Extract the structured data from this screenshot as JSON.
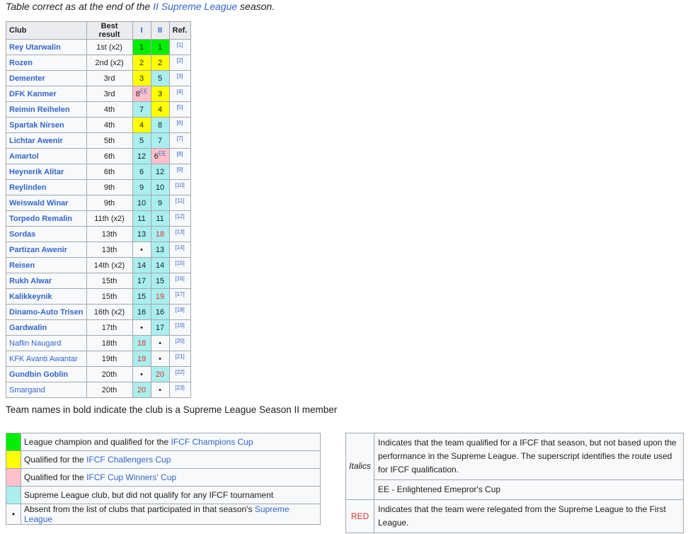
{
  "caption": {
    "prefix": "Table correct as at the end of the ",
    "link": "II Supreme League",
    "suffix": " season."
  },
  "standings": {
    "headers": {
      "club": "Club",
      "best": "Best result",
      "s1": "I",
      "s2": "II",
      "ref": "Ref."
    },
    "rows": [
      {
        "club": "Rey Utarwalin",
        "bold": true,
        "best": "1st (x2)",
        "s1": {
          "v": "1",
          "c": "green"
        },
        "s2": {
          "v": "1",
          "c": "green"
        },
        "ref": "[1]"
      },
      {
        "club": "Rozen",
        "bold": true,
        "best": "2nd (x2)",
        "s1": {
          "v": "2",
          "c": "yellow"
        },
        "s2": {
          "v": "2",
          "c": "yellow"
        },
        "ref": "[2]"
      },
      {
        "club": "Dementer",
        "bold": true,
        "best": "3rd",
        "s1": {
          "v": "3",
          "c": "yellow"
        },
        "s2": {
          "v": "5",
          "c": "cyan"
        },
        "ref": "[3]"
      },
      {
        "club": "DFK Kanmer",
        "bold": true,
        "best": "3rd",
        "s1": {
          "v": "8",
          "c": "pink",
          "sup": "EE"
        },
        "s2": {
          "v": "3",
          "c": "yellow"
        },
        "ref": "[4]"
      },
      {
        "club": "Reimin Reihelen",
        "bold": true,
        "best": "4th",
        "s1": {
          "v": "7",
          "c": "cyan"
        },
        "s2": {
          "v": "4",
          "c": "yellow"
        },
        "ref": "[5]"
      },
      {
        "club": "Spartak Nirsen",
        "bold": true,
        "best": "4th",
        "s1": {
          "v": "4",
          "c": "yellow"
        },
        "s2": {
          "v": "8",
          "c": "cyan"
        },
        "ref": "[6]"
      },
      {
        "club": "Lichtar Awenir",
        "bold": true,
        "best": "5th",
        "s1": {
          "v": "5",
          "c": "cyan"
        },
        "s2": {
          "v": "7",
          "c": "cyan"
        },
        "ref": "[7]"
      },
      {
        "club": "Amartol",
        "bold": true,
        "best": "6th",
        "s1": {
          "v": "12",
          "c": "cyan"
        },
        "s2": {
          "v": "6",
          "c": "pink",
          "sup": "EE"
        },
        "ref": "[8]"
      },
      {
        "club": "Heynerik Alitar",
        "bold": true,
        "best": "6th",
        "s1": {
          "v": "6",
          "c": "cyan"
        },
        "s2": {
          "v": "12",
          "c": "cyan"
        },
        "ref": "[9]"
      },
      {
        "club": "Reylinden",
        "bold": true,
        "best": "9th",
        "s1": {
          "v": "9",
          "c": "cyan"
        },
        "s2": {
          "v": "10",
          "c": "cyan"
        },
        "ref": "[10]"
      },
      {
        "club": "Weiswald Winar",
        "bold": true,
        "best": "9th",
        "s1": {
          "v": "10",
          "c": "cyan"
        },
        "s2": {
          "v": "9",
          "c": "cyan"
        },
        "ref": "[11]"
      },
      {
        "club": "Torpedo Remalin",
        "bold": true,
        "best": "11th (x2)",
        "s1": {
          "v": "11",
          "c": "cyan"
        },
        "s2": {
          "v": "11",
          "c": "cyan"
        },
        "ref": "[12]"
      },
      {
        "club": "Sordas",
        "bold": true,
        "best": "13th",
        "s1": {
          "v": "13",
          "c": "cyan"
        },
        "s2": {
          "v": "18",
          "c": "cyan",
          "red": true
        },
        "ref": "[13]"
      },
      {
        "club": "Partizan Awenir",
        "bold": true,
        "best": "13th",
        "s1": {
          "v": "•",
          "c": "none"
        },
        "s2": {
          "v": "13",
          "c": "cyan"
        },
        "ref": "[14]"
      },
      {
        "club": "Reisen",
        "bold": true,
        "best": "14th (x2)",
        "s1": {
          "v": "14",
          "c": "cyan"
        },
        "s2": {
          "v": "14",
          "c": "cyan"
        },
        "ref": "[15]"
      },
      {
        "club": "Rukh Alwar",
        "bold": true,
        "best": "15th",
        "s1": {
          "v": "17",
          "c": "cyan"
        },
        "s2": {
          "v": "15",
          "c": "cyan"
        },
        "ref": "[16]"
      },
      {
        "club": "Kalikkeynik",
        "bold": true,
        "best": "15th",
        "s1": {
          "v": "15",
          "c": "cyan"
        },
        "s2": {
          "v": "19",
          "c": "cyan",
          "red": true
        },
        "ref": "[17]"
      },
      {
        "club": "Dinamo-Auto Trisen",
        "bold": true,
        "best": "16th (x2)",
        "s1": {
          "v": "16",
          "c": "cyan"
        },
        "s2": {
          "v": "16",
          "c": "cyan"
        },
        "ref": "[18]"
      },
      {
        "club": "Gardwalin",
        "bold": true,
        "best": "17th",
        "s1": {
          "v": "•",
          "c": "none"
        },
        "s2": {
          "v": "17",
          "c": "cyan"
        },
        "ref": "[19]"
      },
      {
        "club": "Naflin Naugard",
        "bold": false,
        "best": "18th",
        "s1": {
          "v": "18",
          "c": "cyan",
          "red": true
        },
        "s2": {
          "v": "•",
          "c": "none"
        },
        "ref": "[20]"
      },
      {
        "club": "KFK Avanti Awantar",
        "bold": false,
        "best": "19th",
        "s1": {
          "v": "19",
          "c": "cyan",
          "red": true
        },
        "s2": {
          "v": "•",
          "c": "none"
        },
        "ref": "[21]"
      },
      {
        "club": "Gundbin Goblin",
        "bold": true,
        "best": "20th",
        "s1": {
          "v": "•",
          "c": "none"
        },
        "s2": {
          "v": "20",
          "c": "cyan",
          "red": true
        },
        "ref": "[22]"
      },
      {
        "club": "Smargand",
        "bold": false,
        "best": "20th",
        "s1": {
          "v": "20",
          "c": "cyan",
          "red": true
        },
        "s2": {
          "v": "•",
          "c": "none"
        },
        "ref": "[23]"
      }
    ]
  },
  "note": "Team names in bold indicate the club is a Supreme League Season II member",
  "legend_left": [
    {
      "swatch": "green",
      "pre": "League champion and qualified for the ",
      "link": "IFCF Champions Cup",
      "post": ""
    },
    {
      "swatch": "yellow",
      "pre": "Qualified for the ",
      "link": "IFCF Challengers Cup",
      "post": ""
    },
    {
      "swatch": "pink",
      "pre": "Qualified for the ",
      "link": "IFCF Cup Winners' Cup",
      "post": ""
    },
    {
      "swatch": "cyan",
      "pre": "Supreme League club, but did not qualify for any IFCF tournament",
      "link": "",
      "post": ""
    },
    {
      "swatch": "none",
      "symbol": "•",
      "pre": "Absent from the list of clubs that participated in that season's ",
      "link": "Supreme League",
      "post": ""
    }
  ],
  "legend_right": {
    "italics_key": "Italics",
    "italics_text": "Indicates that the team qualified for a IFCF that season, but not based upon the performance in the Supreme League. The superscript identifies the route used for IFCF qualification.",
    "ee_text": "EE - Enlightened Emepror's Cup",
    "red_key": "RED",
    "red_text": "Indicates that the team were relegated from the Supreme League to the First League."
  },
  "colors": {
    "green": "#00ee00",
    "yellow": "#ffff00",
    "pink": "#ffc0cb",
    "cyan": "#aaeeee",
    "link": "#3366cc",
    "red": "#dd3333"
  }
}
